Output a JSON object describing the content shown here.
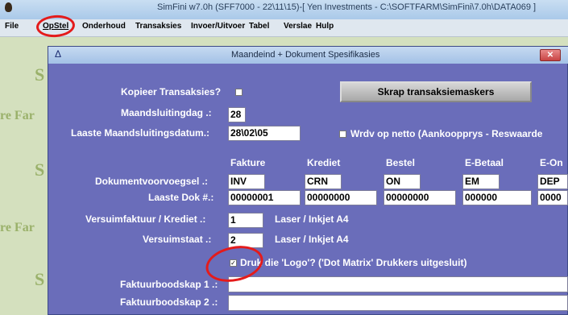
{
  "app": {
    "title": "SimFini w7.0h (SFF7000 - 22\\11\\15)-[ Yen Investments - C:\\SOFTFARM\\SimFini\\7.0h\\DATA069 ]"
  },
  "menu": {
    "file": "File",
    "opstel": "OpStel",
    "onderhoud": "Onderhoud",
    "transaksies": "Transaksies",
    "invoer_uitvoer": "Invoer/Uitvoer",
    "tabel": "Tabel",
    "verslae": "Verslae",
    "hulp": "Hulp"
  },
  "background": {
    "s_letter": "S",
    "re_far": "re Far"
  },
  "dialog": {
    "title": "Maandeind + Dokument Spesifikasies",
    "close_glyph": "✕",
    "kopieer_label": "Kopieer Transaksies?",
    "skrap_button": "Skrap transaksiemaskers",
    "maandsluitingdag_label": "Maandsluitingdag .:",
    "maandsluitingdag_value": "28",
    "laaste_datum_label": "Laaste Maandsluitingsdatum.:",
    "laaste_datum_value": "28\\02\\05",
    "wrdv_label": "Wrdv op netto (Aankoopprys - Reswaarde",
    "columns": [
      "Fakture",
      "Krediet",
      "Bestel",
      "E-Betaal",
      "E-On"
    ],
    "voorvoegsel_label": "Dokumentvoorvoegsel .:",
    "voorvoegsel_values": [
      "INV",
      "CRN",
      "ON",
      "EM",
      "DEP"
    ],
    "laaste_dok_label": "Laaste Dok #.:",
    "laaste_dok_values": [
      "00000001",
      "00000000",
      "00000000",
      "000000",
      "0000"
    ],
    "versuim_faktuur_label": "Versuimfaktuur / Krediet .:",
    "versuim_faktuur_value": "1",
    "versuim_faktuur_printer": "Laser / Inkjet A4",
    "versuimstaat_label": "Versuimstaat .:",
    "versuimstaat_value": "2",
    "versuimstaat_printer": "Laser / Inkjet A4",
    "druk_logo_label": "Druk die 'Logo'? ('Dot Matrix' Drukkers uitgesluit)",
    "druk_logo_check": "✓",
    "boodskap1_label": "Faktuurboodskap 1 .:",
    "boodskap2_label": "Faktuurboodskap 2 .:"
  }
}
